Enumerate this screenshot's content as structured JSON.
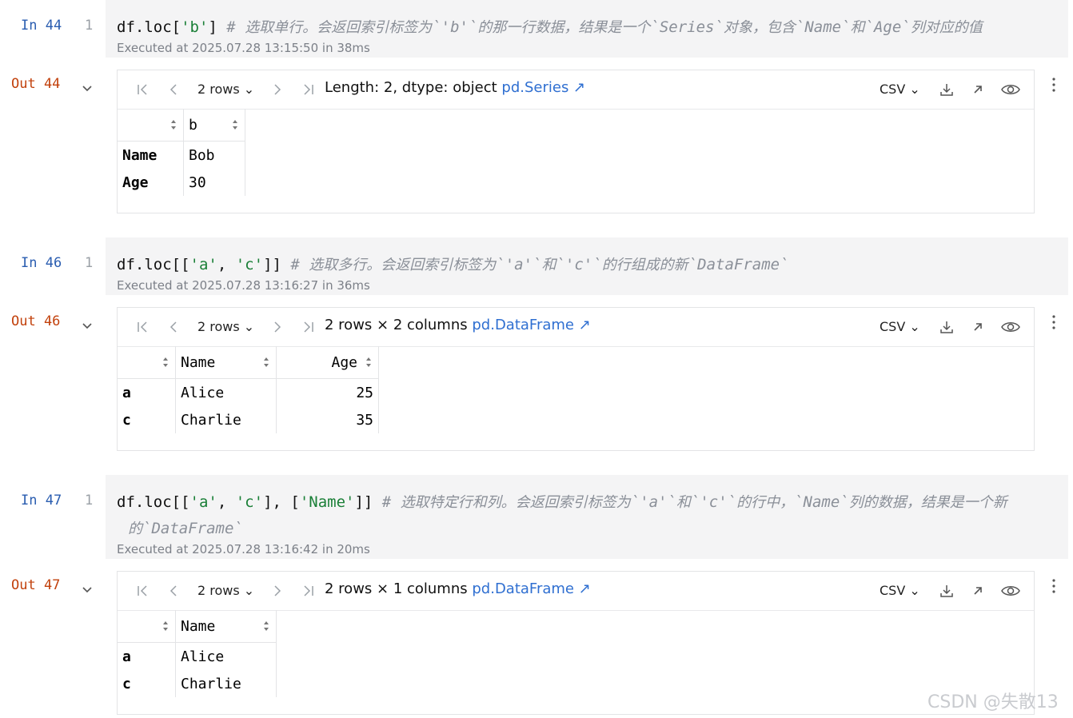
{
  "cells": [
    {
      "in_label": "In 44",
      "line_no": "1",
      "code": {
        "p1": "df.loc[",
        "s1": "'b'",
        "p2": "] ",
        "c_pre": "# ",
        "c1": "选取单行。会返回索引标签为",
        "cm1": "`'b'`",
        "c2": "的那一行数据，结果是一个",
        "cm2": "`Series`",
        "c3": "对象，包含",
        "cm3": "`Name`",
        "c4": "和",
        "cm4": "`Age`",
        "c5": "列对应的值"
      },
      "executed": "Executed at 2025.07.28 13:15:50 in 38ms",
      "out_label": "Out 44",
      "rows_selector": "2 rows",
      "summary": "Length: 2, dtype: object",
      "type_link": "pd.Series ↗",
      "csv_label": "CSV",
      "columns": [
        "",
        "b"
      ],
      "rows": [
        [
          "Name",
          "Bob"
        ],
        [
          "Age",
          "30"
        ]
      ]
    },
    {
      "in_label": "In 46",
      "line_no": "1",
      "code": {
        "p1": "df.loc[[",
        "s1": "'a'",
        "p2": ", ",
        "s2": "'c'",
        "p3": "]] ",
        "c_pre": "# ",
        "c1": "选取多行。会返回索引标签为",
        "cm1": "`'a'`",
        "c2": "和",
        "cm2": "`'c'`",
        "c3": "的行组成的新",
        "cm3": "`DataFrame`"
      },
      "executed": "Executed at 2025.07.28 13:16:27 in 36ms",
      "out_label": "Out 46",
      "rows_selector": "2 rows",
      "summary": "2 rows × 2 columns",
      "type_link": "pd.DataFrame ↗",
      "csv_label": "CSV",
      "columns": [
        "",
        "Name",
        "Age"
      ],
      "rows": [
        [
          "a",
          "Alice",
          "25"
        ],
        [
          "c",
          "Charlie",
          "35"
        ]
      ]
    },
    {
      "in_label": "In 47",
      "line_no": "1",
      "code": {
        "p1": "df.loc[[",
        "s1": "'a'",
        "p2": ", ",
        "s2": "'c'",
        "p3": "], [",
        "s3": "'Name'",
        "p4": "]] ",
        "c_pre": "# ",
        "c1": "选取特定行和列。会返回索引标签为",
        "cm1": "`'a'`",
        "c2": "和",
        "cm2": "`'c'`",
        "c3": "的行中，",
        "cm3": "`Name`",
        "c4": "列的数据，结果是一个新",
        "c5": "的",
        "cm5": "`DataFrame`",
        "c6": ""
      },
      "executed": "Executed at 2025.07.28 13:16:42 in 20ms",
      "out_label": "Out 47",
      "rows_selector": "2 rows",
      "summary": "2 rows × 1 columns",
      "type_link": "pd.DataFrame ↗",
      "csv_label": "CSV",
      "columns": [
        "",
        "Name"
      ],
      "rows": [
        [
          "a",
          "Alice"
        ],
        [
          "c",
          "Charlie"
        ]
      ]
    }
  ],
  "watermark": "CSDN @失散13",
  "colors": {
    "in_prompt": "#2a5db0",
    "out_prompt": "#c2410c",
    "string": "#1a7f37",
    "link": "#2f6fd1"
  }
}
